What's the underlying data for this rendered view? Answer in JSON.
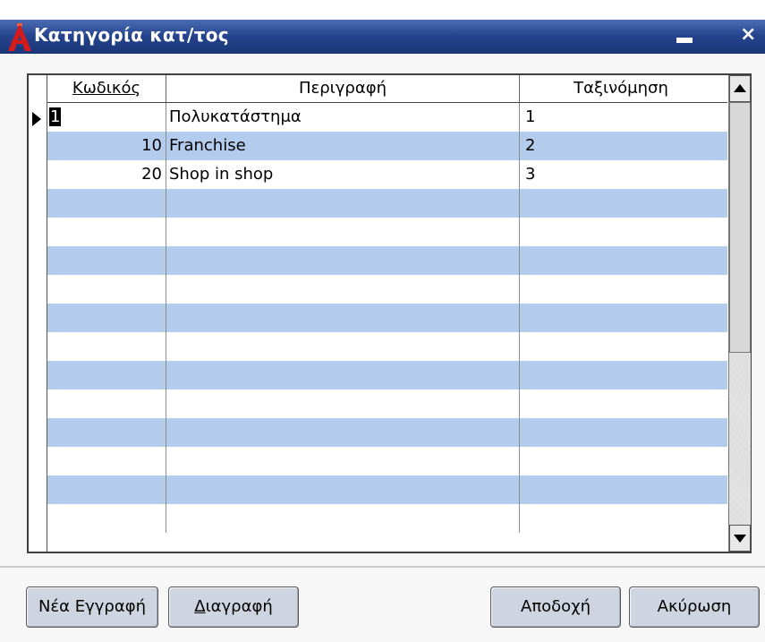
{
  "window": {
    "title": "Κατηγορία κατ/τος",
    "minimize_label": "",
    "close_label": "×"
  },
  "grid": {
    "columns": [
      "Κωδικός",
      "Περιγραφή",
      "Ταξινόμηση"
    ],
    "rows": [
      {
        "code": "1",
        "description": "Πολυκατάστημα",
        "sort": "1"
      },
      {
        "code": "10",
        "description": "Franchise",
        "sort": "2"
      },
      {
        "code": "20",
        "description": "Shop in shop",
        "sort": "3"
      }
    ],
    "empty_rows": 12
  },
  "buttons": {
    "new": "Νέα Εγγραφή",
    "delete_first": "Δ",
    "delete_rest": "ιαγραφή",
    "accept": "Αποδοχή",
    "cancel": "Ακύρωση"
  },
  "colors": {
    "titlebar": "#26458f",
    "alt_row": "#b3cbec"
  }
}
